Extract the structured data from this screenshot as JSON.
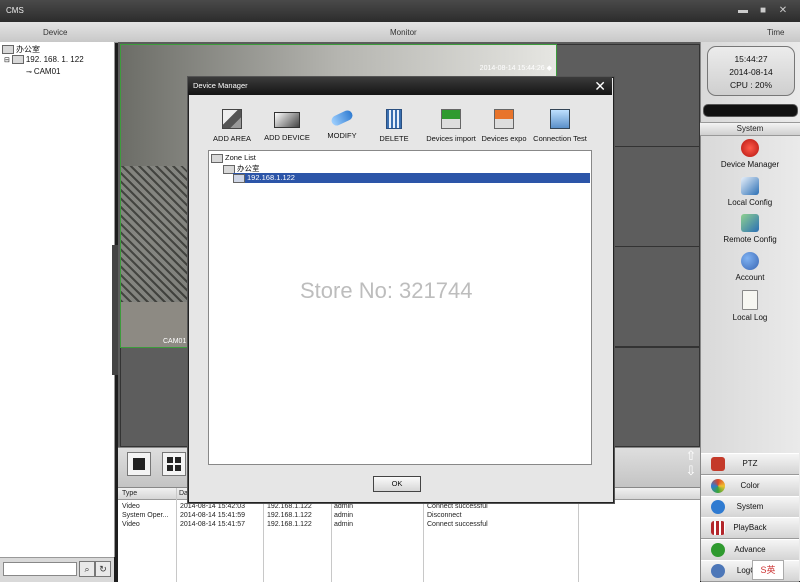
{
  "window": {
    "title": "CMS",
    "buttons": [
      "▬",
      "■",
      "✕"
    ]
  },
  "header": {
    "device": "Device",
    "monitor": "Monitor",
    "time": "Time"
  },
  "device_tree": {
    "root": "办公室",
    "device": "192. 168. 1. 122",
    "camera": "CAM01"
  },
  "video": {
    "timestamp": "2014-08-14 15:44:26 ◆",
    "camera_label": "CAM01"
  },
  "clock": {
    "time": "15:44:27",
    "date": "2014-08-14",
    "cpu": "CPU : 20%"
  },
  "system_panel": {
    "header": "System",
    "items": [
      {
        "label": "Device Manager",
        "icon": "device-manager-icon",
        "color": "#c91e1e"
      },
      {
        "label": "Local Config",
        "icon": "local-config-icon",
        "color": "#2b6fb5"
      },
      {
        "label": "Remote Config",
        "icon": "remote-config-icon",
        "color": "#3c8c3c"
      },
      {
        "label": "Account",
        "icon": "account-icon",
        "color": "#3a66b3"
      },
      {
        "label": "Local Log",
        "icon": "local-log-icon",
        "color": "#f4f4f4"
      }
    ]
  },
  "bottom_buttons": [
    {
      "label": "PTZ",
      "icon": "ptz-icon",
      "color": "#c43a2a"
    },
    {
      "label": "Color",
      "icon": "color-icon",
      "color": "#d9452a"
    },
    {
      "label": "System",
      "icon": "system-icon",
      "color": "#2f7bd1"
    },
    {
      "label": "PlayBack",
      "icon": "playback-icon",
      "color": "#b3262a"
    },
    {
      "label": "Advance",
      "icon": "advance-icon",
      "color": "#2f9a2f"
    },
    {
      "label": "LogOut",
      "icon": "logout-icon",
      "color": "#4d77b8"
    }
  ],
  "log": {
    "columns": [
      "Type",
      "Da",
      "",
      "",
      "",
      ""
    ],
    "rows": [
      {
        "type": "Video",
        "time": "2014-08-14 15:42:03",
        "ip": "192.168.1.122",
        "user": "admin",
        "msg": "Connect successful"
      },
      {
        "type": "System Oper...",
        "time": "2014-08-14 15:41:59",
        "ip": "192.168.1.122",
        "user": "admin",
        "msg": "Disconnect"
      },
      {
        "type": "Video",
        "time": "2014-08-14 15:41:57",
        "ip": "192.168.1.122",
        "user": "admin",
        "msg": "Connect successful"
      }
    ]
  },
  "dialog": {
    "title": "Device Manager",
    "toolbar": [
      {
        "label": "ADD AREA",
        "icon": "add-area-icon"
      },
      {
        "label": "ADD DEVICE",
        "icon": "add-device-icon"
      },
      {
        "label": "MODIFY",
        "icon": "modify-icon"
      },
      {
        "label": "DELETE",
        "icon": "delete-icon"
      },
      {
        "label": "Devices import",
        "icon": "devices-import-icon"
      },
      {
        "label": "Devices expo",
        "icon": "devices-export-icon"
      },
      {
        "label": "Connection  Test",
        "icon": "connection-test-icon"
      }
    ],
    "tree": {
      "zone_list": "Zone List",
      "area": "办公室",
      "device": "192.168.1.122"
    },
    "ok": "OK"
  },
  "watermark": "Store No: 321744",
  "ime": "S英"
}
